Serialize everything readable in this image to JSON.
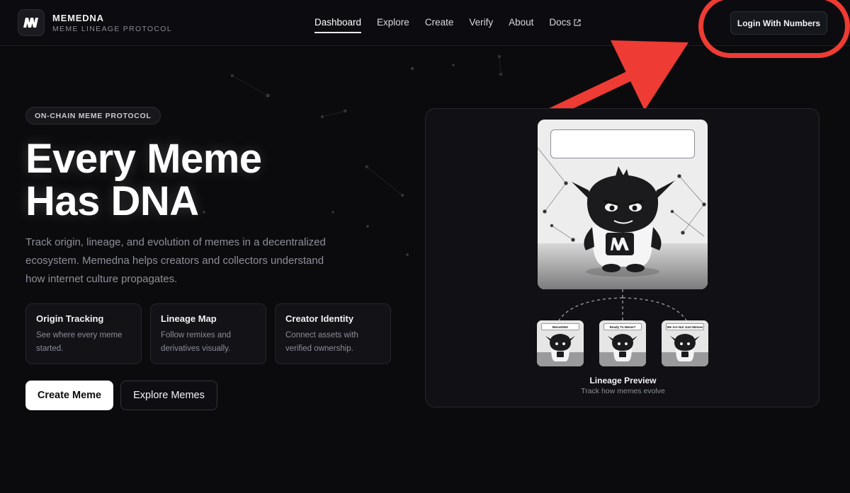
{
  "brand": {
    "name": "MEMEDNA",
    "tagline": "MEME LINEAGE PROTOCOL",
    "logo_icon": "memedna-logo-icon"
  },
  "nav": {
    "items": [
      {
        "label": "Dashboard",
        "active": true
      },
      {
        "label": "Explore",
        "active": false
      },
      {
        "label": "Create",
        "active": false
      },
      {
        "label": "Verify",
        "active": false
      },
      {
        "label": "About",
        "active": false
      },
      {
        "label": "Docs",
        "active": false,
        "icon": "external-link-icon"
      }
    ]
  },
  "header": {
    "login_label": "Login With Numbers"
  },
  "annotation": {
    "color": "#ee3b34",
    "shapes": [
      "ring-around-login",
      "arrow-pointing-to-login"
    ]
  },
  "hero": {
    "badge": "ON-CHAIN MEME PROTOCOL",
    "title_line1": "Every Meme",
    "title_line2": "Has DNA",
    "subtitle": "Track origin, lineage, and evolution of memes in a decentralized ecosystem. Memedna helps creators and collectors understand how internet culture propagates."
  },
  "features": [
    {
      "title": "Origin Tracking",
      "desc": "See where every meme started."
    },
    {
      "title": "Lineage Map",
      "desc": "Follow remixes and derivatives visually."
    },
    {
      "title": "Creator Identity",
      "desc": "Connect assets with verified ownership."
    }
  ],
  "actions": {
    "primary": "Create Meme",
    "secondary": "Explore Memes"
  },
  "preview": {
    "title": "Lineage Preview",
    "subtitle": "Track how memes evolve",
    "children_captions": [
      "MemeDNA",
      "Ready To Meme?",
      "We Are Not Just Memes"
    ]
  },
  "colors": {
    "background": "#0b0b0e",
    "card": "#111115",
    "accent_annotation": "#ee3b34",
    "text_muted": "#8d8f99"
  }
}
